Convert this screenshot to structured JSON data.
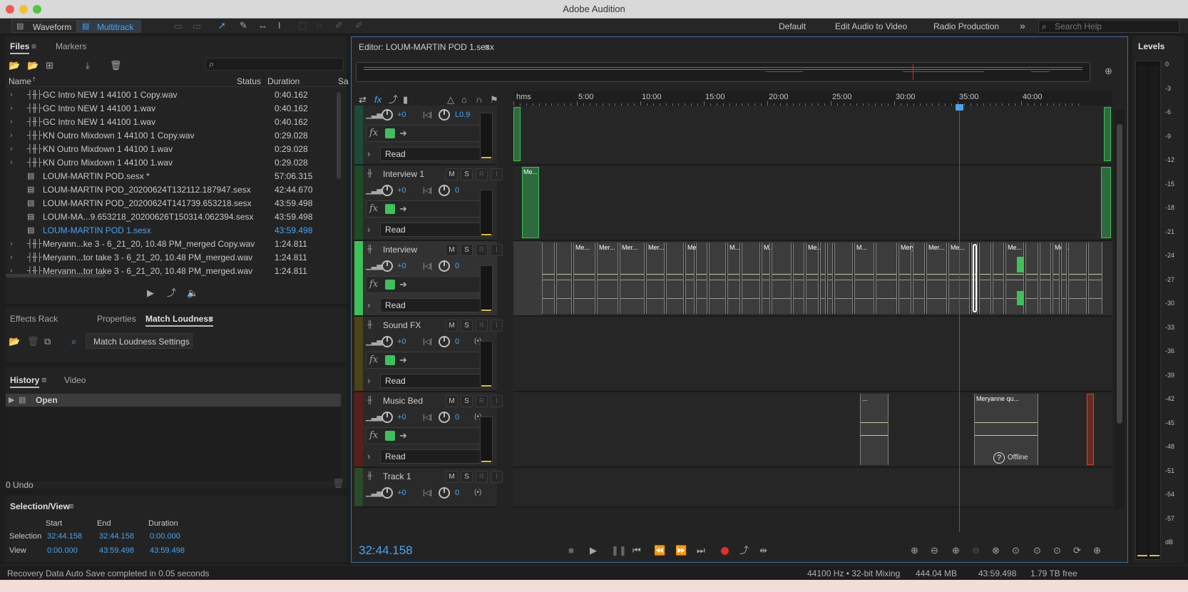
{
  "app": {
    "title": "Adobe Audition"
  },
  "toolbar": {
    "waveform_label": "Waveform",
    "multitrack_label": "Multitrack",
    "workspaces": [
      "Default",
      "Edit Audio to Video",
      "Radio Production"
    ],
    "more": "»",
    "search_placeholder": "Search Help"
  },
  "files_panel": {
    "tabs": [
      "Files",
      "Markers"
    ],
    "columns": {
      "name": "Name",
      "status": "Status",
      "duration": "Duration",
      "extra": "Sa"
    },
    "items": [
      {
        "name": "GC Intro NEW 1 44100 1 Copy.wav",
        "duration": "0:40.162",
        "type": "wav",
        "expandable": true,
        "selected": false
      },
      {
        "name": "GC Intro NEW 1 44100 1.wav",
        "duration": "0:40.162",
        "type": "wav",
        "expandable": true,
        "selected": false
      },
      {
        "name": "GC Intro NEW 1 44100 1.wav",
        "duration": "0:40.162",
        "type": "wav",
        "expandable": true,
        "selected": false
      },
      {
        "name": "KN Outro Mixdown 1 44100 1 Copy.wav",
        "duration": "0:29.028",
        "type": "wav",
        "expandable": true,
        "selected": false
      },
      {
        "name": "KN Outro Mixdown 1 44100 1.wav",
        "duration": "0:29.028",
        "type": "wav",
        "expandable": true,
        "selected": false
      },
      {
        "name": "KN Outro Mixdown 1 44100 1.wav",
        "duration": "0:29.028",
        "type": "wav",
        "expandable": true,
        "selected": false
      },
      {
        "name": "LOUM-MARTIN POD.sesx *",
        "duration": "57:06.315",
        "type": "sesx",
        "expandable": false,
        "selected": false
      },
      {
        "name": "LOUM-MARTIN POD_20200624T132112.187947.sesx",
        "duration": "42:44.670",
        "type": "sesx",
        "expandable": false,
        "selected": false
      },
      {
        "name": "LOUM-MARTIN POD_20200624T141739.653218.sesx",
        "duration": "43:59.498",
        "type": "sesx",
        "expandable": false,
        "selected": false
      },
      {
        "name": "LOUM-MA...9.653218_20200626T150314.062394.sesx",
        "duration": "43:59.498",
        "type": "sesx",
        "expandable": false,
        "selected": false
      },
      {
        "name": "LOUM-MARTIN POD 1.sesx",
        "duration": "43:59.498",
        "type": "sesx",
        "expandable": false,
        "selected": true
      },
      {
        "name": "Meryann...ke 3 - 6_21_20, 10.48 PM_merged Copy.wav",
        "duration": "1:24.811",
        "type": "wav",
        "expandable": true,
        "selected": false
      },
      {
        "name": "Meryann...tor take 3 - 6_21_20, 10.48 PM_merged.wav",
        "duration": "1:24.811",
        "type": "wav",
        "expandable": true,
        "selected": false
      },
      {
        "name": "Meryann...tor take 3 - 6_21_20, 10.48 PM_merged.wav",
        "duration": "1:24.811",
        "type": "wav",
        "expandable": true,
        "selected": false
      }
    ]
  },
  "effects_panel": {
    "tabs": [
      "Effects Rack",
      "Properties",
      "Match Loudness"
    ],
    "settings_button": "Match Loudness Settings"
  },
  "history_panel": {
    "tabs": [
      "History",
      "Video"
    ],
    "items": [
      "Open"
    ],
    "undo_count": "0 Undo"
  },
  "selection_view": {
    "title": "Selection/View",
    "headers": [
      "Start",
      "End",
      "Duration"
    ],
    "rows": [
      {
        "label": "Selection",
        "start": "32:44.158",
        "end": "32:44.158",
        "duration": "0:00.000"
      },
      {
        "label": "View",
        "start": "0:00.000",
        "end": "43:59.498",
        "duration": "43:59.498"
      }
    ]
  },
  "status_bar": {
    "message": "Recovery Data Auto Save completed in 0.05 seconds",
    "sample_rate": "44100 Hz • 32-bit Mixing",
    "memory": "444.04 MB",
    "duration": "43:59.498",
    "free_space": "1.79 TB free"
  },
  "editor": {
    "title": "Editor: LOUM-MARTIN POD 1.sesx",
    "time_display": "32:44.158",
    "ruler": [
      "hms",
      "5:00",
      "10:00",
      "15:00",
      "20:00",
      "25:00",
      "30:00",
      "35:00",
      "40:00"
    ],
    "playhead_fraction": 0.744,
    "tracks": [
      {
        "name": "",
        "volume": "+0",
        "pan": "L0.9",
        "automation": "Read",
        "color": "#1e4a3a",
        "clips": [
          {
            "label": ""
          },
          {
            "label": ""
          }
        ]
      },
      {
        "name": "Interview 1",
        "volume": "+0",
        "pan": "0",
        "automation": "Read",
        "color": "#1e4a2a",
        "clips": [
          {
            "label": "Me..."
          },
          {
            "label": ""
          }
        ]
      },
      {
        "name": "Interview",
        "volume": "+0",
        "pan": "0",
        "automation": "Read",
        "color": "#3ec05a",
        "clip_labels": [
          "Me...",
          "Mer...",
          "Mer...",
          "Mer...",
          "Mer...",
          "M...",
          "M...",
          "Me...",
          "M...",
          "Mery...",
          "Mer...",
          "Me...",
          "Me...",
          "Mer..."
        ]
      },
      {
        "name": "Sound FX",
        "volume": "+0",
        "pan": "0",
        "automation": "Read",
        "color": "#4a4418"
      },
      {
        "name": "Music Bed",
        "volume": "+0",
        "pan": "0",
        "automation": "Read",
        "color": "#5a1e1e",
        "clips": [
          {
            "label": "..."
          },
          {
            "label": "Meryanne qu..."
          }
        ],
        "offline_label": "Offline"
      },
      {
        "name": "Track 1",
        "volume": "+0",
        "pan": "0",
        "automation": "",
        "color": "#2a4a2a"
      }
    ],
    "track_buttons": {
      "mute": "M",
      "solo": "S",
      "record": "R",
      "input": "I"
    }
  },
  "levels": {
    "title": "Levels",
    "scale": [
      "0",
      "-3",
      "-6",
      "-9",
      "-12",
      "-15",
      "-18",
      "-21",
      "-24",
      "-27",
      "-30",
      "-33",
      "-36",
      "-39",
      "-42",
      "-45",
      "-48",
      "-51",
      "-54",
      "-57",
      "dB"
    ]
  },
  "colors": {
    "accent": "#4aa3ee",
    "clip_green": "#3ec05a",
    "playhead": "#c83232"
  }
}
